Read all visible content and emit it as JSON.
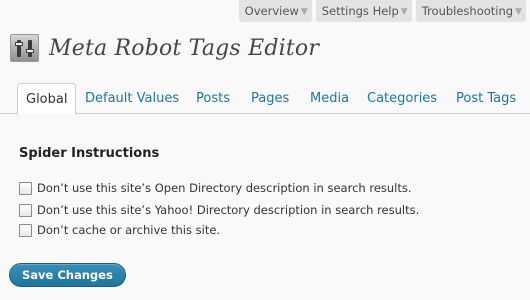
{
  "meta_links": [
    {
      "label": "Overview"
    },
    {
      "label": "Settings Help"
    },
    {
      "label": "Troubleshooting"
    }
  ],
  "header": {
    "title": "Meta Robot Tags Editor",
    "icon": "sliders-icon"
  },
  "tabs": [
    {
      "label": "Global",
      "active": true
    },
    {
      "label": "Default Values"
    },
    {
      "label": "Posts"
    },
    {
      "label": "Pages"
    },
    {
      "label": "Media"
    },
    {
      "label": "Categories"
    },
    {
      "label": "Post Tags"
    }
  ],
  "section": {
    "heading": "Spider Instructions",
    "options": [
      {
        "label": "Don’t use this site’s Open Directory description in search results.",
        "checked": false
      },
      {
        "label": "Don’t use this site’s Yahoo! Directory description in search results.",
        "checked": false
      },
      {
        "label": "Don’t cache or archive this site.",
        "checked": false
      }
    ]
  },
  "actions": {
    "save_label": "Save Changes"
  },
  "colors": {
    "link": "#21759b",
    "button": "#21759b"
  }
}
